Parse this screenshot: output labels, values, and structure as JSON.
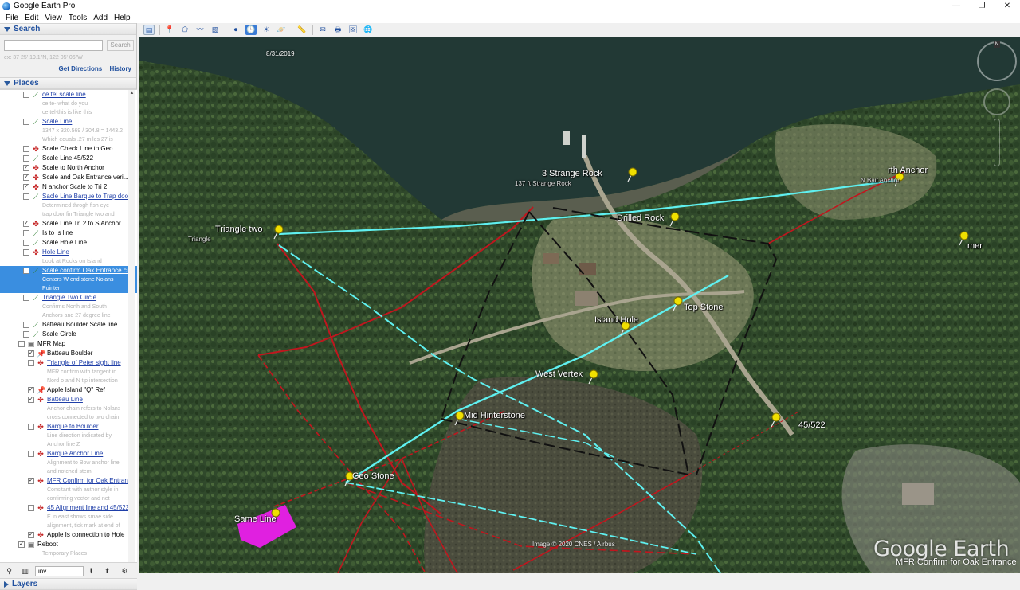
{
  "window": {
    "title": "Google Earth Pro",
    "controls": {
      "minimize": "—",
      "restore": "❐",
      "close": "✕"
    }
  },
  "menu": [
    "File",
    "Edit",
    "View",
    "Tools",
    "Add",
    "Help"
  ],
  "search": {
    "header": "Search",
    "input_value": "",
    "button": "Search",
    "hint": "ex: 37 25' 19.1\"N, 122 05' 06\"W",
    "get_directions": "Get Directions",
    "history": "History"
  },
  "places": {
    "header": "Places",
    "items": [
      {
        "type": "path",
        "checked": false,
        "label": "ce tel scale line",
        "link": true
      },
      {
        "type": "sub",
        "label": "ce te- what do you"
      },
      {
        "type": "sub",
        "label": "ce tel-this is like this"
      },
      {
        "type": "path",
        "checked": false,
        "label": "Scale Line",
        "link": true
      },
      {
        "type": "sub",
        "label": "1347 x 320.569 / 304.8 = 1443.2"
      },
      {
        "type": "sub",
        "label": "Which equals .27 miles 27 is"
      },
      {
        "type": "poly",
        "checked": false,
        "label": "Scale Check Line to Geo",
        "link": false
      },
      {
        "type": "path",
        "checked": false,
        "label": "Scale Line 45/522",
        "link": false
      },
      {
        "type": "poly",
        "checked": true,
        "label": "Scale to North Anchor",
        "link": false
      },
      {
        "type": "poly",
        "checked": true,
        "label": "Scale and Oak Entrance veri...",
        "link": false
      },
      {
        "type": "poly",
        "checked": true,
        "label": "N anchor Scale to Tri 2",
        "link": false
      },
      {
        "type": "path",
        "checked": false,
        "label": "Sacle Line Barque to Trap door",
        "link": true
      },
      {
        "type": "sub",
        "label": "Determined throgh fish eye"
      },
      {
        "type": "sub",
        "label": "trap door fin Triangle two and"
      },
      {
        "type": "poly",
        "checked": true,
        "label": "Scale Line Tri 2 to S Anchor",
        "link": false
      },
      {
        "type": "path",
        "checked": false,
        "label": "Is to Is line",
        "link": false
      },
      {
        "type": "path",
        "checked": false,
        "label": "Scale Hole Line",
        "link": false
      },
      {
        "type": "poly",
        "checked": false,
        "label": "Hole Line",
        "link": true
      },
      {
        "type": "sub",
        "label": "Look at Rocks on Island"
      },
      {
        "type": "path",
        "checked": false,
        "label": "Scale confirm Oak Entrance cir",
        "link": true,
        "selected": true
      },
      {
        "type": "sub",
        "label": "Centers W end stone Nolans",
        "selected": true
      },
      {
        "type": "sub",
        "label": "Pointer",
        "selected": true
      },
      {
        "type": "path",
        "checked": false,
        "label": "Triangle Two Circle",
        "link": true
      },
      {
        "type": "sub",
        "label": "Confirms North and South"
      },
      {
        "type": "sub",
        "label": "Anchors and 27 degree line"
      },
      {
        "type": "path",
        "checked": false,
        "label": "Batteau Boulder Scale line",
        "link": false
      },
      {
        "type": "path",
        "checked": false,
        "label": "Scale Circle",
        "link": false
      },
      {
        "type": "folder",
        "checked": false,
        "label": "MFR Map",
        "link": false
      },
      {
        "type": "pin",
        "checked": true,
        "label": "Batteau Boulder",
        "link": false
      },
      {
        "type": "poly",
        "checked": false,
        "label": "Triangle of Peter sight line",
        "link": true
      },
      {
        "type": "sub",
        "label": "MFR confirm with tangent in"
      },
      {
        "type": "sub",
        "label": "Nord o and N tip intersection"
      },
      {
        "type": "pin",
        "checked": true,
        "label": "Apple Island \"Q\" Ref",
        "link": false
      },
      {
        "type": "poly",
        "checked": true,
        "label": "Batteau Line",
        "link": true
      },
      {
        "type": "sub",
        "label": "Anchor chain refers to Nolans"
      },
      {
        "type": "sub",
        "label": "cross connected to two chain"
      },
      {
        "type": "poly",
        "checked": false,
        "label": "Barque to Boulder",
        "link": true
      },
      {
        "type": "sub",
        "label": "Line direction indicated by"
      },
      {
        "type": "sub",
        "label": "Anchor line Z"
      },
      {
        "type": "poly",
        "checked": false,
        "label": "Barque Anchor Line",
        "link": true
      },
      {
        "type": "sub",
        "label": "Alignment to Bow anchor line"
      },
      {
        "type": "sub",
        "label": "and notched stem"
      },
      {
        "type": "poly",
        "checked": true,
        "label": "MFR Confirm for Oak Entrance",
        "link": true
      },
      {
        "type": "sub",
        "label": "Consitant with author style in"
      },
      {
        "type": "sub",
        "label": "confirming vector and net"
      },
      {
        "type": "poly",
        "checked": false,
        "label": "45 Alignment line and 45/522",
        "link": true
      },
      {
        "type": "sub",
        "label": "E in east shows smae side"
      },
      {
        "type": "sub",
        "label": "alignment, tick mark at end of"
      },
      {
        "type": "poly",
        "checked": true,
        "label": "Apple Is connection to Hole",
        "link": false
      },
      {
        "type": "folder",
        "checked": true,
        "label": "Reboot",
        "link": false
      },
      {
        "type": "sub",
        "label": "Temporary Places"
      }
    ]
  },
  "bottom_search": {
    "value": "inv"
  },
  "layers": {
    "header": "Layers"
  },
  "toolbar": {
    "buttons": [
      "sidebar-toggle",
      "placemark",
      "polygon",
      "path",
      "image-overlay",
      "record-tour",
      "historical-imagery",
      "sunlight",
      "planets",
      "ruler",
      "email",
      "print",
      "save-image",
      "view-in-maps"
    ],
    "icons": [
      "▤",
      "📍",
      "⬠",
      "〰",
      "▧",
      "⏺",
      "🕒",
      "☀",
      "🪐",
      "📏",
      "✉",
      "🖶",
      "🖼",
      "🌐"
    ]
  },
  "map": {
    "date": "8/31/2019",
    "imagery_credit": "Image © 2020 CNES / Airbus",
    "logo": "Google Earth",
    "tour_caption": "MFR Confirm for Oak Entrance",
    "labels": [
      {
        "id": "strange-rock",
        "text": "3 Strange Rock",
        "sub": "137 ft Strange Rock"
      },
      {
        "id": "north-anchor",
        "text": "rth Anchor",
        "sub": "N Bait Anchor"
      },
      {
        "id": "drilled-rock",
        "text": "Drilled Rock",
        "sub": ""
      },
      {
        "id": "triangle",
        "text": "Triangle two",
        "sub": "Triangle"
      },
      {
        "id": "mer",
        "text": "mer",
        "sub": ""
      },
      {
        "id": "top-stone",
        "text": "Top Stone",
        "sub": ""
      },
      {
        "id": "island-hole",
        "text": "Island Hole",
        "sub": ""
      },
      {
        "id": "west-vertex",
        "text": "West Vertex",
        "sub": ""
      },
      {
        "id": "mid-hinterstone",
        "text": "Mid Hinterstone",
        "sub": ""
      },
      {
        "id": "45-522",
        "text": "45/522",
        "sub": ""
      },
      {
        "id": "geo-stone",
        "text": "Geo Stone",
        "sub": ""
      },
      {
        "id": "same-line",
        "text": "Same Line",
        "sub": ""
      }
    ]
  },
  "colors": {
    "water": "#233a36",
    "forest": "#2f4a2a",
    "clearing": "#6d7a58",
    "cyan_line": "#5ff0f0",
    "red_line": "#c0161e",
    "black_line": "#111111",
    "pin": "#f0e000",
    "magenta": "#e020e0",
    "accent_blue": "#1f4f9e"
  }
}
